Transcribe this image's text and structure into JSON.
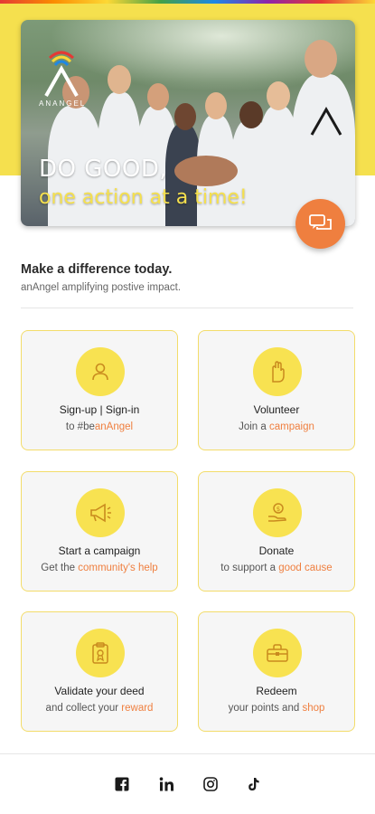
{
  "hero": {
    "logo_text": "ANANGEL",
    "line1": "DO GOOD,",
    "line2": "one action at a time!"
  },
  "chat_icon": "chat-bubbles-icon",
  "intro": {
    "title": "Make a difference today.",
    "subtitle": "anAngel amplifying postive impact."
  },
  "cards": [
    {
      "icon": "user-icon",
      "title": "Sign-up | Sign-in",
      "sub_prefix": "to #be",
      "sub_highlight": "anAngel",
      "sub_suffix": ""
    },
    {
      "icon": "raised-hand-icon",
      "title": "Volunteer",
      "sub_prefix": "Join a ",
      "sub_highlight": "campaign",
      "sub_suffix": ""
    },
    {
      "icon": "megaphone-icon",
      "title": "Start a campaign",
      "sub_prefix": "Get the ",
      "sub_highlight": "community's help",
      "sub_suffix": ""
    },
    {
      "icon": "donate-hand-icon",
      "title": "Donate",
      "sub_prefix": "to support a ",
      "sub_highlight": "good cause",
      "sub_suffix": ""
    },
    {
      "icon": "clipboard-icon",
      "title": "Validate your deed",
      "sub_prefix": "and collect your ",
      "sub_highlight": "reward",
      "sub_suffix": ""
    },
    {
      "icon": "gift-box-icon",
      "title": "Redeem",
      "sub_prefix": "your points and ",
      "sub_highlight": "shop",
      "sub_suffix": ""
    }
  ],
  "social": [
    "facebook-icon",
    "linkedin-icon",
    "instagram-icon",
    "tiktok-icon"
  ],
  "colors": {
    "accent": "#ef7f3f",
    "yellow": "#f8e251",
    "card_border": "#f3dc6a"
  }
}
